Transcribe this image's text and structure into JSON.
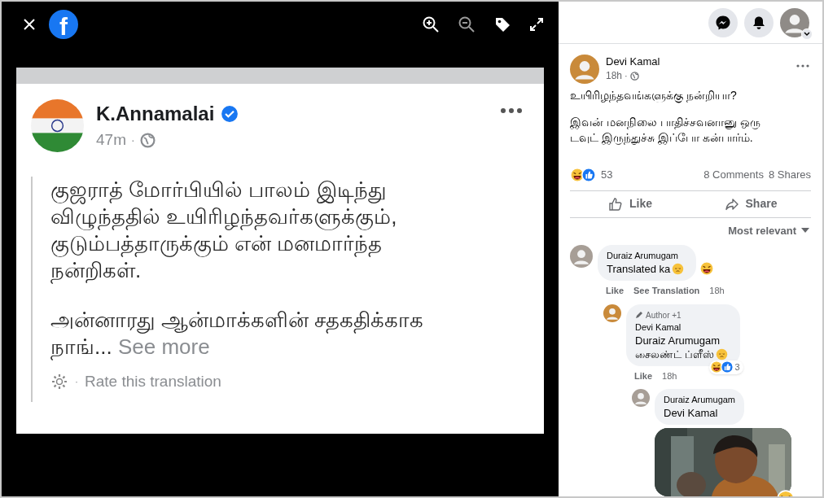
{
  "viewer": {
    "logo": "f"
  },
  "embedded_post": {
    "author": "K.Annamalai",
    "verified": true,
    "time": "47m",
    "time_separator": "·",
    "rate_separator": "·",
    "paragraphs": [
      "குஜராத் மோர்பியில் பாலம் இடிந்து\nவிழுந்ததில் உயிரிழந்தவர்களுக்கும்,\nகுடும்பத்தாருக்கும் என் மனமார்ந்த\nநன்றிகள்.",
      "அன்னாரது ஆன்மாக்களின் சதகதிக்காக\nநாங்..."
    ],
    "see_more": "See more",
    "rate_translation": "Rate this translation"
  },
  "post": {
    "author": "Devi Kamal",
    "time": "18h",
    "time_separator": "·",
    "paragraphs": [
      "உயிரிழந்தவங்களுக்கு நன்றியா?",
      "இவன் மனநிலை பாதிச்சவனானு ஒரு\nடவுட் இருந்துச்சு இப்போ கன்பார்ம்."
    ],
    "reaction_count": "53",
    "comments": "8 Comments",
    "shares": "8 Shares",
    "actions": [
      "Like",
      "Share"
    ],
    "sort": "Most relevant"
  },
  "comments": [
    {
      "author": "Duraiz Arumugam",
      "text": "Translated ka",
      "reacted": true,
      "actions": [
        "Like",
        "See Translation"
      ],
      "time": "18h",
      "children": [
        {
          "author": "Devi Kamal",
          "badge": "Author +1",
          "mention": "Duraiz Arumugam",
          "text": "சைலண்ட் ப்ளீஸ்",
          "reaction_count": "3",
          "actions": [
            "Like"
          ],
          "time": "18h",
          "children": [
            {
              "author": "Duraiz Arumugam",
              "mention": "Devi Kamal",
              "reacted": true
            }
          ]
        }
      ]
    }
  ]
}
